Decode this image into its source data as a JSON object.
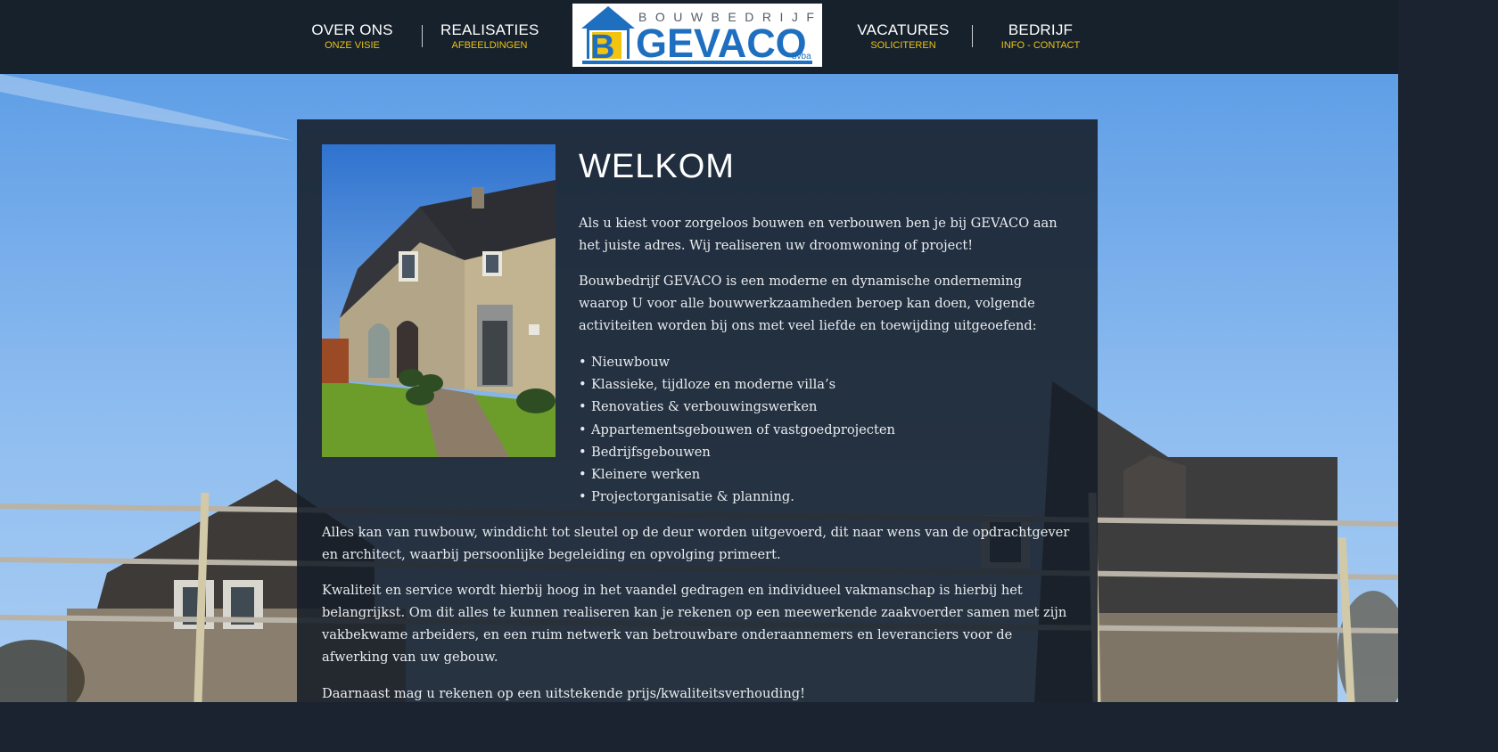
{
  "header": {
    "nav_left": [
      {
        "main": "OVER ONS",
        "sub": "ONZE VISIE"
      },
      {
        "main": "REALISATIES",
        "sub": "AFBEELDINGEN"
      }
    ],
    "nav_right": [
      {
        "main": "VACATURES",
        "sub": "SOLICITEREN"
      },
      {
        "main": "BEDRIJF",
        "sub": "INFO - CONTACT"
      }
    ],
    "logo": {
      "top_text": "BOUWBEDRIJF",
      "name": "GEVACO",
      "suffix": "bvba",
      "letter": "B"
    }
  },
  "colors": {
    "header_bg": "#17212c",
    "nav_sub": "#e8c21a",
    "logo_blue": "#1e6fc0",
    "logo_yellow": "#f2c40f",
    "panel_bg": "#161e28"
  },
  "main": {
    "title": "WELKOM",
    "intro": "Als u kiest voor zorgeloos bouwen en verbouwen ben je bij GEVACO aan het juiste adres. Wij realiseren uw droomwoning of project!",
    "description": "Bouwbedrijf GEVACO is een moderne en dynamische onderneming waarop U voor alle bouwwerkzaamheden beroep kan doen, volgende activiteiten worden bij ons met veel liefde en toewijding uitgeoefend:",
    "activities": [
      "Nieuwbouw",
      "Klassieke, tijdloze en moderne villa’s",
      "Renovaties & verbouwingswerken",
      "Appartementsgebouwen of vastgoedprojecten",
      "Bedrijfsgebouwen",
      "Kleinere werken",
      "Projectorganisatie & planning."
    ],
    "paragraph_1": "Alles kan van ruwbouw, winddicht tot sleutel op de deur worden uitgevoerd, dit naar wens van de opdrachtgever en architect, waarbij persoonlijke begeleiding en opvolging primeert.",
    "paragraph_2": "Kwaliteit en service wordt hierbij hoog in het vaandel gedragen en individueel vakmanschap is hierbij het belangrijkst. Om dit alles te kunnen realiseren kan je rekenen op een meewerkende zaakvoerder samen met zijn vakbekwame arbeiders, en een ruim netwerk van betrouwbare onderaannemers en leveranciers voor de afwerking van uw gebouw.",
    "paragraph_3": "Daarnaast mag u rekenen op een uitstekende prijs/kwaliteitsverhouding!"
  }
}
